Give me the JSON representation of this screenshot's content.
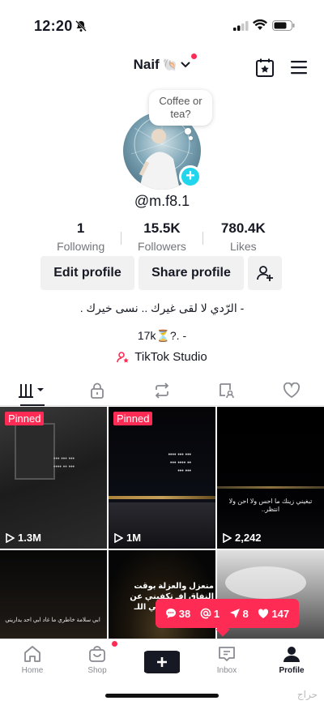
{
  "status_bar": {
    "time": "12:20"
  },
  "header": {
    "username": "Naif",
    "emoji": "🐚"
  },
  "note": {
    "text": "Coffee or tea?"
  },
  "profile": {
    "handle": "@m.f8.1"
  },
  "stats": [
    {
      "value": "1",
      "label": "Following"
    },
    {
      "value": "15.5K",
      "label": "Followers"
    },
    {
      "value": "780.4K",
      "label": "Likes"
    }
  ],
  "buttons": {
    "edit": "Edit profile",
    "share": "Share profile"
  },
  "bio": {
    "line1": "- الرّدي لا لقى غيرك .. نسى خيرك .",
    "line2": "17k⏳?. -"
  },
  "studio": {
    "label": "TikTok Studio"
  },
  "videos": [
    {
      "pinned_label": "Pinned",
      "views": "1.3M",
      "caption": ""
    },
    {
      "pinned_label": "Pinned",
      "views": "1M",
      "caption": ""
    },
    {
      "pinned_label": "",
      "views": "2,242",
      "caption": "تبغيني زينك ما احس ولا احن ولا انتظر.."
    },
    {
      "pinned_label": "",
      "views": "",
      "caption": "ابي سلامة خاطري ما غاد ابي احد يداريني"
    },
    {
      "pinned_label": "",
      "views": "",
      "caption": "منعزل والعزلة بوقت النفاق افـ تكفيني عن الناس وتبعد عني اللـ"
    },
    {
      "pinned_label": "",
      "views": "",
      "caption": ""
    }
  ],
  "activity": {
    "comments": "38",
    "mentions": "1",
    "shares": "8",
    "likes": "147"
  },
  "nav": {
    "home": "Home",
    "shop": "Shop",
    "inbox": "Inbox",
    "profile": "Profile"
  },
  "watermark": "حراج",
  "colors": {
    "accent": "#fe2c55",
    "cyan": "#20d5ec",
    "text": "#161823"
  }
}
